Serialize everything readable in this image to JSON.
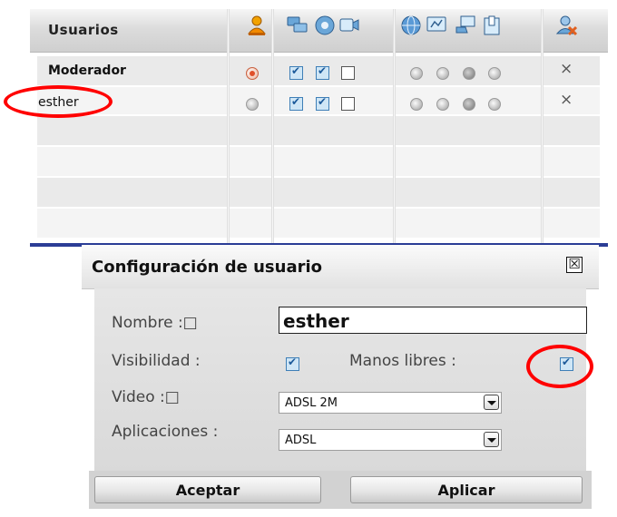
{
  "users_panel": {
    "title": "Usuarios",
    "users": [
      {
        "name": "Moderador",
        "moderator": true,
        "checks": [
          true,
          true,
          false
        ],
        "radios": [
          "normal",
          "normal",
          "dark",
          "normal"
        ],
        "remove": "×"
      },
      {
        "name": "esther",
        "moderator": false,
        "checks": [
          true,
          true,
          false
        ],
        "radios": [
          "normal",
          "normal",
          "dark",
          "normal"
        ],
        "remove": "×"
      }
    ],
    "header_icons": [
      "moderator-icon",
      "chat-icon",
      "audio-icon",
      "video-icon",
      "globe-icon",
      "whiteboard-icon",
      "share-icon",
      "clipboard-icon",
      "remove-user-icon"
    ],
    "accent_color": "#2b3d96"
  },
  "dialog": {
    "title": "Configuración de usuario",
    "close_label": "☒",
    "name_label": "Nombre :□",
    "name_value": "esther",
    "visibility_label": "Visibilidad :",
    "visibility_checked": true,
    "hands_free_label": "Manos libres :",
    "hands_free_checked": true,
    "video_label": "Video :□",
    "video_value": "ADSL 2M",
    "apps_label": "Aplicaciones :",
    "apps_value": "ADSL",
    "accept_label": "Aceptar",
    "apply_label": "Aplicar"
  },
  "annotation_color": "#ff0000"
}
